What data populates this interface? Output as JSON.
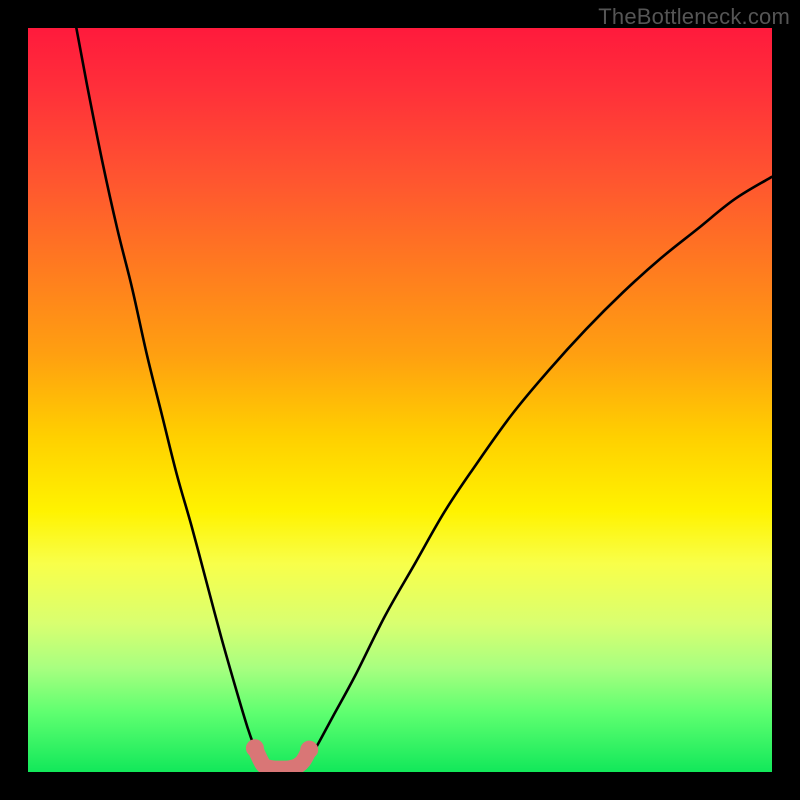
{
  "watermark": "TheBottleneck.com",
  "colors": {
    "black": "#000000",
    "curve": "#000000",
    "trough_marker": "#d97676",
    "gradient_top": "#ff1a3c",
    "gradient_bottom": "#12e85a"
  },
  "chart_data": {
    "type": "line",
    "title": "",
    "xlabel": "",
    "ylabel": "",
    "xlim": [
      0,
      100
    ],
    "ylim": [
      0,
      100
    ],
    "series": [
      {
        "name": "left-branch",
        "x": [
          6.5,
          8,
          10,
          12,
          14,
          16,
          18,
          20,
          22,
          24,
          26,
          28,
          29.5,
          30.5,
          31.3,
          31.8
        ],
        "y": [
          100,
          92,
          82,
          73,
          65,
          56,
          48,
          40,
          33,
          25.5,
          18,
          11,
          6,
          3.2,
          1.5,
          0.8
        ]
      },
      {
        "name": "right-branch",
        "x": [
          37,
          37.8,
          39,
          41,
          44,
          48,
          52,
          56,
          60,
          65,
          70,
          75,
          80,
          85,
          90,
          95,
          100
        ],
        "y": [
          0.8,
          1.8,
          3.8,
          7.5,
          13,
          21,
          28,
          35,
          41,
          48,
          54,
          59.5,
          64.5,
          69,
          73,
          77,
          80
        ]
      },
      {
        "name": "trough-highlight",
        "x": [
          30.5,
          31.3,
          31.8,
          32.8,
          34,
          35.2,
          36.2,
          37,
          37.8
        ],
        "y": [
          3.2,
          1.5,
          0.8,
          0.5,
          0.45,
          0.5,
          0.8,
          1.5,
          3.0
        ]
      }
    ],
    "annotations": []
  }
}
